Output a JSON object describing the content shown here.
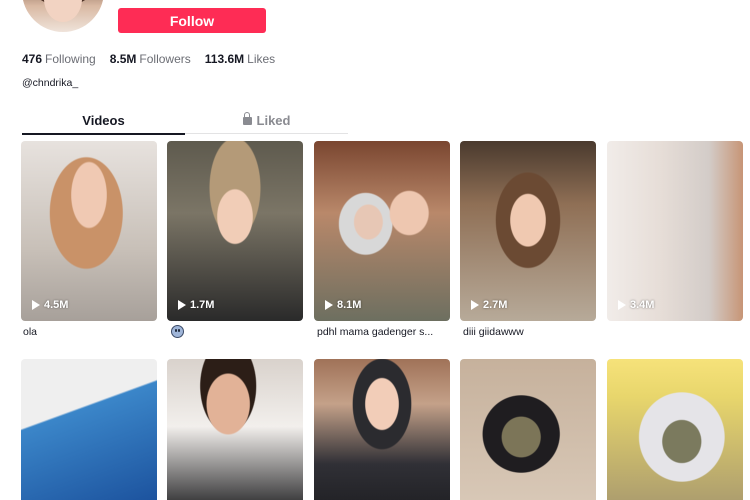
{
  "profile": {
    "follow_label": "Follow",
    "handle": "@chndrika_",
    "stats": [
      {
        "value": "476",
        "label": "Following"
      },
      {
        "value": "8.5M",
        "label": "Followers"
      },
      {
        "value": "113.6M",
        "label": "Likes"
      }
    ]
  },
  "tabs": {
    "videos": "Videos",
    "liked": "Liked"
  },
  "videos": [
    {
      "views": "4.5M",
      "caption": "ola"
    },
    {
      "views": "1.7M",
      "caption": "",
      "caption_icon": "face-emoji-icon"
    },
    {
      "views": "8.1M",
      "caption": "pdhl mama gadenger s..."
    },
    {
      "views": "2.7M",
      "caption": "diii giidawww"
    },
    {
      "views": "3.4M",
      "caption": ""
    }
  ],
  "colors": {
    "follow_button": "#fe2c55",
    "text_primary": "#161823",
    "text_secondary": "#6b6d74"
  }
}
